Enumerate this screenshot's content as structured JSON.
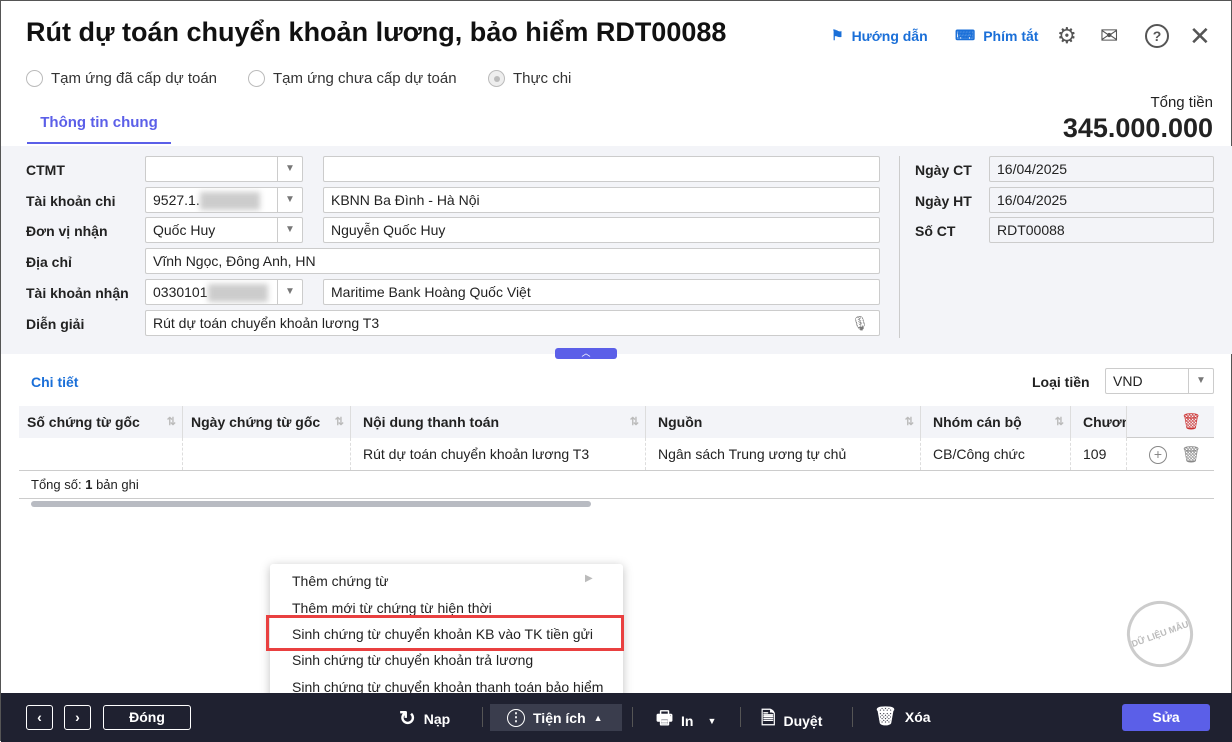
{
  "header": {
    "title": "Rút dự toán chuyển khoản lương, bảo hiểm RDT00088",
    "guide": "Hướng dẫn",
    "shortcuts": "Phím tắt"
  },
  "radios": [
    {
      "label": "Tạm ứng đã cấp dự toán",
      "checked": false
    },
    {
      "label": "Tạm ứng chưa cấp dự toán",
      "checked": false
    },
    {
      "label": "Thực chi",
      "checked": true
    }
  ],
  "tab": "Thông tin chung",
  "total": {
    "label": "Tổng tiền",
    "value": "345.000.000"
  },
  "form": {
    "ctmt": {
      "label": "CTMT",
      "code": "",
      "name": ""
    },
    "tk_chi": {
      "label": "Tài khoản chi",
      "code": "9527.1.",
      "name": "KBNN Ba Đình - Hà Nội"
    },
    "don_vi": {
      "label": "Đơn vị nhận",
      "code": "Quốc Huy",
      "name": "Nguyễn Quốc Huy"
    },
    "dia_chi": {
      "label": "Địa chỉ",
      "value": "Vĩnh Ngọc, Đông Anh, HN"
    },
    "tk_nhan": {
      "label": "Tài khoản nhận",
      "code": "0330101",
      "name": "Maritime Bank Hoàng Quốc Việt"
    },
    "dien_giai": {
      "label": "Diễn giải",
      "value": "Rút dự toán chuyển khoản lương T3"
    },
    "ngay_ct": {
      "label": "Ngày CT",
      "value": "16/04/2025"
    },
    "ngay_ht": {
      "label": "Ngày HT",
      "value": "16/04/2025"
    },
    "so_ct": {
      "label": "Số CT",
      "value": "RDT00088"
    }
  },
  "detail": {
    "title": "Chi tiết",
    "currency_label": "Loại tiền",
    "currency": "VND",
    "columns": [
      "Số chứng từ gốc",
      "Ngày chứng từ gốc",
      "Nội dung thanh toán",
      "Nguồn",
      "Nhóm cán bộ",
      "Chương"
    ],
    "rows": [
      [
        "",
        "",
        "Rút dự toán chuyển khoản lương T3",
        "Ngân sách Trung ương tự chủ",
        "CB/Công chức",
        "109"
      ]
    ],
    "total_prefix": "Tổng số:",
    "total_count": "1",
    "total_suffix": "bản ghi"
  },
  "menu": [
    "Thêm chứng từ",
    "Thêm mới từ chứng từ hiện thời",
    "Sinh chứng từ chuyển khoản KB vào TK tiền gửi",
    "Sinh chứng từ chuyển khoản trả lương",
    "Sinh chứng từ chuyển khoản thanh toán bảo hiểm"
  ],
  "watermark": "DỮ LIỆU MẪU",
  "footer": {
    "close": "Đóng",
    "reload": "Nạp",
    "utilities": "Tiện ích",
    "print": "In",
    "approve": "Duyệt",
    "delete": "Xóa",
    "edit": "Sửa"
  }
}
